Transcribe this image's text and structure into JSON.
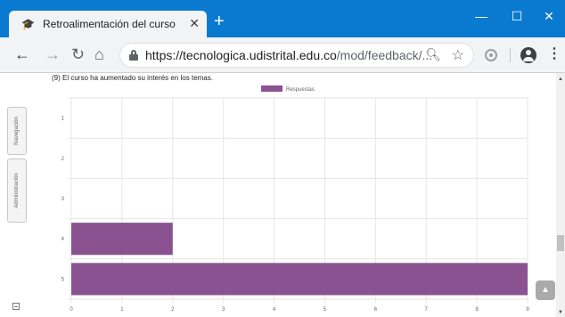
{
  "browser": {
    "tab_title": "Retroalimentación del curso",
    "tab_favicon": "moodle-icon",
    "url_host": "https://tecnologica.udistrital.edu.co",
    "url_path": "/mod/feedback/..."
  },
  "sidebar": {
    "navigation_label": "Navegación",
    "administration_label": "Administración"
  },
  "question": {
    "text": "(9) El curso ha aumentado su interés en los temas."
  },
  "colors": {
    "bar": "#8a5290",
    "titlebar": "#0a7ad0"
  },
  "chart_data": {
    "type": "bar",
    "orientation": "horizontal",
    "title": "",
    "categories": [
      "1",
      "2",
      "3",
      "4",
      "5"
    ],
    "series": [
      {
        "name": "Respuestas",
        "values": [
          0,
          0,
          0,
          2,
          9
        ]
      }
    ],
    "xlim": [
      0,
      9
    ],
    "x_ticks": [
      "0",
      "1",
      "2",
      "3",
      "4",
      "5",
      "6",
      "7",
      "8",
      "9"
    ],
    "grid": true,
    "legend": "top"
  }
}
